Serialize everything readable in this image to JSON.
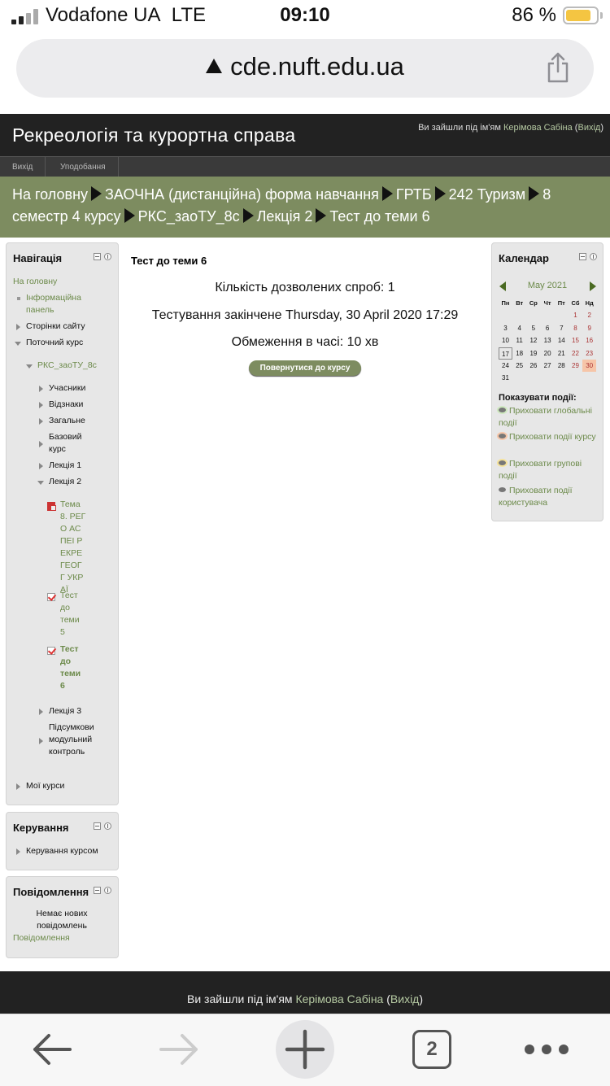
{
  "status_bar": {
    "carrier": "Vodafone UA",
    "network": "LTE",
    "time": "09:10",
    "battery_percent": "86 %",
    "battery_level": 0.86
  },
  "browser": {
    "url": "cde.nuft.edu.ua",
    "tab_count": "2"
  },
  "header": {
    "site_title": "Рекреологія та курортна справа",
    "login_prefix": "Ви зайшли під ім'ям",
    "user_name": "Керімова Сабіна",
    "logout": "Вихід"
  },
  "menu": {
    "items": [
      "Вихід",
      "Уподобання"
    ]
  },
  "breadcrumb": {
    "items": [
      "На головну",
      "ЗАОЧНА (дистанційна) форма навчання",
      "ГРТБ",
      "242 Туризм",
      "8 семестр 4 курсу",
      "РКС_заоТУ_8с",
      "Лекція 2",
      "Тест до теми 6"
    ]
  },
  "navigation": {
    "title": "Навігація",
    "home": "На головну",
    "dashboard": "Інформаційна панель",
    "site_pages": "Сторінки сайту",
    "current_course": "Поточний курс",
    "course_code": "РКС_заоТУ_8с",
    "sections": [
      "Учасники",
      "Відзнаки",
      "Загальне",
      "Базовий курс",
      "Лекція 1",
      "Лекція 2"
    ],
    "lecture2_items": [
      "Тема 8. РЕГО АСПЕІ РЕКРЕ ГЕОГГ УКРАЇ",
      "Тест до теми 5",
      "Тест до теми 6"
    ],
    "lecture3": "Лекція 3",
    "final_module": "Підсумкови модульний контроль",
    "my_courses": "Мої курси"
  },
  "admin": {
    "title": "Керування",
    "course_admin": "Керування курсом"
  },
  "messages": {
    "title": "Повідомлення",
    "no_new": "Немає нових повідомлень",
    "link": "Повідомлення"
  },
  "main": {
    "title": "Тест до теми 6",
    "attempts": "Кількість дозволених спроб: 1",
    "closed": "Тестування закінчене Thursday, 30 April 2020 17:29",
    "time_limit": "Обмеження в часі: 10 хв",
    "back_button": "Повернутися до курсу"
  },
  "calendar": {
    "title": "Календар",
    "month": "May 2021",
    "weekdays": [
      "Пн",
      "Вт",
      "Ср",
      "Чт",
      "Пт",
      "Сб",
      "Нд"
    ],
    "weeks": [
      [
        "",
        "",
        "",
        "",
        "",
        "1",
        "2"
      ],
      [
        "3",
        "4",
        "5",
        "6",
        "7",
        "8",
        "9"
      ],
      [
        "10",
        "11",
        "12",
        "13",
        "14",
        "15",
        "16"
      ],
      [
        "17",
        "18",
        "19",
        "20",
        "21",
        "22",
        "23"
      ],
      [
        "24",
        "25",
        "26",
        "27",
        "28",
        "29",
        "30"
      ],
      [
        "31",
        "",
        "",
        "",
        "",
        "",
        ""
      ]
    ],
    "today": "17",
    "event_day": "30",
    "events_title": "Показувати події:",
    "event_toggles": [
      "Приховати глобальні події",
      "Приховати події курсу",
      "Приховати групові події",
      "Приховати події користувача"
    ]
  },
  "footer": {
    "prefix": "Ви зайшли під ім'ям",
    "user_name": "Керімова Сабіна",
    "logout": "Вихід"
  },
  "colors": {
    "header_bg": "#222222",
    "breadcrumb_bg": "#7d8c60",
    "link": "#6c8a4a",
    "block_bg": "#e7e7e7",
    "battery": "#f4c542"
  }
}
